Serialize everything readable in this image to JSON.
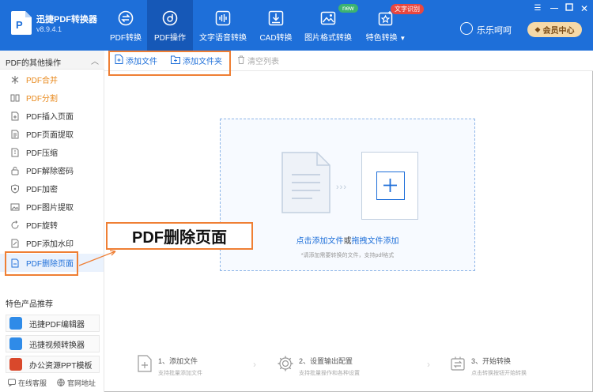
{
  "app": {
    "name": "迅捷PDF转换器",
    "version": "v8.9.4.1"
  },
  "nav": [
    {
      "label": "PDF转换",
      "icon": "convert-icon"
    },
    {
      "label": "PDF操作",
      "icon": "pdf-operate-icon",
      "active": true
    },
    {
      "label": "文字语音转换",
      "icon": "voice-wave-icon"
    },
    {
      "label": "CAD转换",
      "icon": "cad-icon"
    },
    {
      "label": "图片格式转换",
      "icon": "image-icon",
      "badge": "new"
    },
    {
      "label": "特色转换",
      "icon": "special-icon",
      "badge": "文字识别",
      "dropdown_icon": "caret-down-icon"
    }
  ],
  "window_controls": [
    "menu-icon",
    "minimize-icon",
    "maximize-icon",
    "close-icon"
  ],
  "user": {
    "name": "乐乐呵呵",
    "vip_label": "会员中心"
  },
  "sidebar": {
    "header": "PDF的其他操作",
    "items": [
      {
        "label": "PDF合并",
        "icon": "merge-icon"
      },
      {
        "label": "PDF分割",
        "icon": "split-icon"
      },
      {
        "label": "PDF插入页面",
        "icon": "insert-page-icon"
      },
      {
        "label": "PDF页面提取",
        "icon": "extract-page-icon"
      },
      {
        "label": "PDF压缩",
        "icon": "compress-icon"
      },
      {
        "label": "PDF解除密码",
        "icon": "unlock-icon"
      },
      {
        "label": "PDF加密",
        "icon": "shield-icon"
      },
      {
        "label": "PDF图片提取",
        "icon": "image-extract-icon"
      },
      {
        "label": "PDF旋转",
        "icon": "rotate-icon"
      },
      {
        "label": "PDF添加水印",
        "icon": "watermark-icon"
      },
      {
        "label": "PDF删除页面",
        "icon": "delete-page-icon"
      }
    ],
    "recommend_title": "特色产品推荐",
    "recommend": [
      {
        "label": "迅捷PDF编辑器",
        "icon": "pdf-editor-icon",
        "color": "#2f8be8"
      },
      {
        "label": "迅捷视频转换器",
        "icon": "video-converter-icon",
        "color": "#2f8be8"
      },
      {
        "label": "办公资源PPT模板",
        "icon": "ppt-template-icon",
        "color": "#d9482b"
      }
    ],
    "footer": [
      {
        "label": "在线客服",
        "icon": "chat-icon"
      },
      {
        "label": "官网地址",
        "icon": "globe-icon"
      }
    ]
  },
  "toolbar": {
    "add_file": "添加文件",
    "add_folder": "添加文件夹",
    "clear_list": "清空列表"
  },
  "dropzone": {
    "link1": "点击添加文件",
    "middle": "或",
    "link2": "拖拽文件添加",
    "hint": "*请添加需要转换的文件，支持pdf格式"
  },
  "callout": "PDF删除页面",
  "steps": [
    {
      "title": "1、添加文件",
      "sub": "支持批量添加文件",
      "icon": "add-file-step-icon"
    },
    {
      "title": "2、设置输出配置",
      "sub": "支持批量操作和各种设置",
      "icon": "settings-gear-icon"
    },
    {
      "title": "3、开始转换",
      "sub": "点击转换按钮开始转换",
      "icon": "start-convert-icon"
    }
  ],
  "colors": {
    "header_bg": "#1e6fd9",
    "active_tab_bg": "#1658b7",
    "accent_blue": "#1e6fd9",
    "highlight_orange": "#ef7f34",
    "badge_green": "#3cb371",
    "badge_red": "#e9473f",
    "vip_gold": "#f5d9a8"
  }
}
